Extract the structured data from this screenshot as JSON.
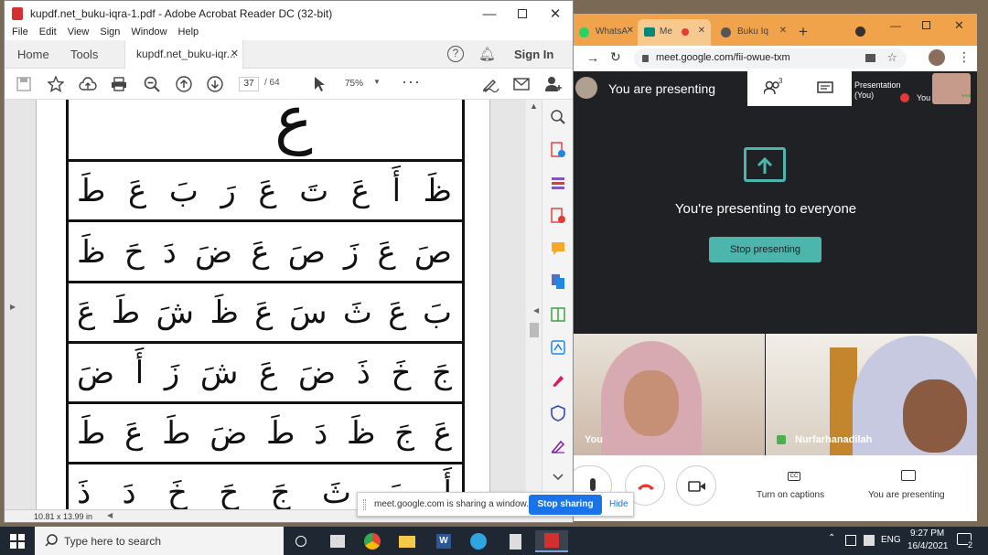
{
  "acrobat": {
    "title": "kupdf.net_buku-iqra-1.pdf - Adobe Acrobat Reader DC (32-bit)",
    "menu": [
      "File",
      "Edit",
      "View",
      "Sign",
      "Window",
      "Help"
    ],
    "tabs": {
      "home": "Home",
      "tools": "Tools",
      "doc": "kupdf.net_buku-iqr...",
      "sign_in": "Sign In"
    },
    "page_current": "37",
    "page_total": "/ 64",
    "zoom": "75%",
    "page_size": "10.81 x 13.99 in",
    "pdf_top_glyph": "ع",
    "pdf_rows": [
      [
        "ظَ",
        "أَ",
        "عَ",
        "تَ",
        "عَ",
        "رَ",
        "بَ",
        "عَ",
        "طَ"
      ],
      [
        "صَ",
        "عَ",
        "زَ",
        "صَ",
        "عَ",
        "ضَ",
        "دَ",
        "حَ",
        "ظَ"
      ],
      [
        "بَ",
        "عَ",
        "ثَ",
        "سَ",
        "عَ",
        "ظَ",
        "شَ",
        "طَ",
        "عَ"
      ],
      [
        "جَ",
        "خَ",
        "ذَ",
        "ضَ",
        "عَ",
        "شَ",
        "زَ",
        "أَ",
        "ضَ"
      ],
      [
        "عَ",
        "جَ",
        "ظَ",
        "دَ",
        "طَ",
        "ضَ",
        "طَ",
        "عَ",
        "طَ"
      ],
      [
        "أَ",
        "بَ",
        "ثَ",
        "جَ",
        "حَ",
        "خَ",
        "دَ",
        "ذَ"
      ]
    ]
  },
  "chrome": {
    "tabs": [
      "WhatsA",
      "Me",
      "Buku Iq"
    ],
    "url": "meet.google.com/fii-owue-txm"
  },
  "meet": {
    "presenting_title": "You are presenting",
    "participant_count": "3",
    "presentation_label": "Presentation\n(You)",
    "you_label": "You",
    "main_message": "You're presenting to everyone",
    "stop_presenting": "Stop presenting",
    "tile_you": "You",
    "tile_other": "Nurfarhanadilah",
    "captions_label": "Turn on captions",
    "presenting_label": "You are presenting"
  },
  "sharebar": {
    "message": "meet.google.com is sharing a window.",
    "stop": "Stop sharing",
    "hide": "Hide"
  },
  "taskbar": {
    "search_placeholder": "Type here to search",
    "lang": "ENG",
    "time": "9:27 PM",
    "date": "16/4/2021",
    "notif_count": "2"
  },
  "colors": {
    "meet_teal": "#4db6ac",
    "share_blue": "#1a73e8",
    "chrome_tab": "#f0a34a",
    "acrobat_red": "#d32f2f"
  }
}
